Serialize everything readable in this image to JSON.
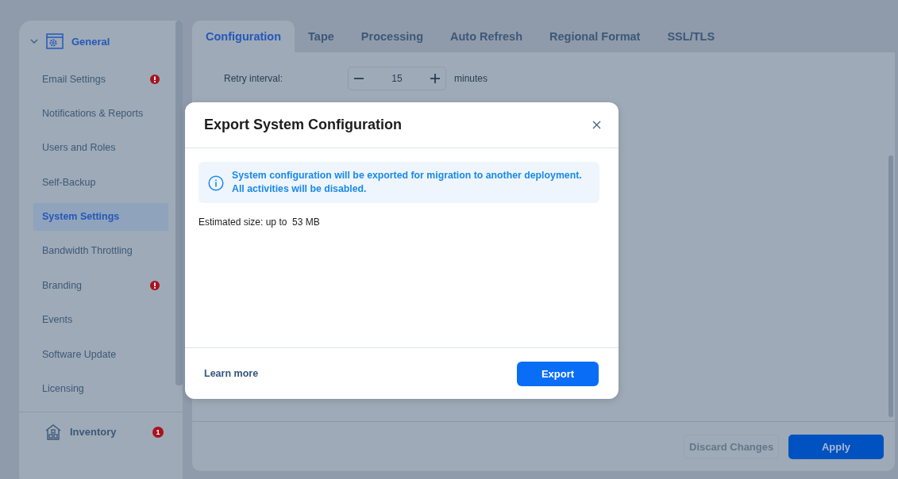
{
  "sidebar": {
    "sections": [
      {
        "label": "General",
        "expanded": true,
        "items": [
          {
            "label": "Email Settings",
            "selected": false,
            "warning": true
          },
          {
            "label": "Notifications & Reports",
            "selected": false,
            "warning": false
          },
          {
            "label": "Users and Roles",
            "selected": false,
            "warning": false
          },
          {
            "label": "Self-Backup",
            "selected": false,
            "warning": false
          },
          {
            "label": "System Settings",
            "selected": true,
            "warning": false
          },
          {
            "label": "Bandwidth Throttling",
            "selected": false,
            "warning": false
          },
          {
            "label": "Branding",
            "selected": false,
            "warning": true
          },
          {
            "label": "Events",
            "selected": false,
            "warning": false
          },
          {
            "label": "Software Update",
            "selected": false,
            "warning": false
          },
          {
            "label": "Licensing",
            "selected": false,
            "warning": false
          }
        ]
      },
      {
        "label": "Inventory",
        "badge": "1"
      }
    ]
  },
  "tabs": [
    {
      "label": "Configuration",
      "selected": true
    },
    {
      "label": "Tape",
      "selected": false
    },
    {
      "label": "Processing",
      "selected": false
    },
    {
      "label": "Auto Refresh",
      "selected": false
    },
    {
      "label": "Regional Format",
      "selected": false
    },
    {
      "label": "SSL/TLS",
      "selected": false
    }
  ],
  "settings": {
    "label": "Retry interval:",
    "value": "15",
    "unit": "minutes"
  },
  "footer": {
    "buttons": [
      {
        "label": "Discard Changes",
        "disabled": true,
        "primary": false
      },
      {
        "label": "Apply",
        "disabled": false,
        "primary": true
      }
    ]
  },
  "dialog": {
    "title": "Export System Configuration",
    "info": "System configuration will be exported for migration to another deployment. All activities will be disabled.",
    "estimate": "Estimated size: up to  53 MB",
    "link": "Learn more",
    "button": "Export"
  }
}
